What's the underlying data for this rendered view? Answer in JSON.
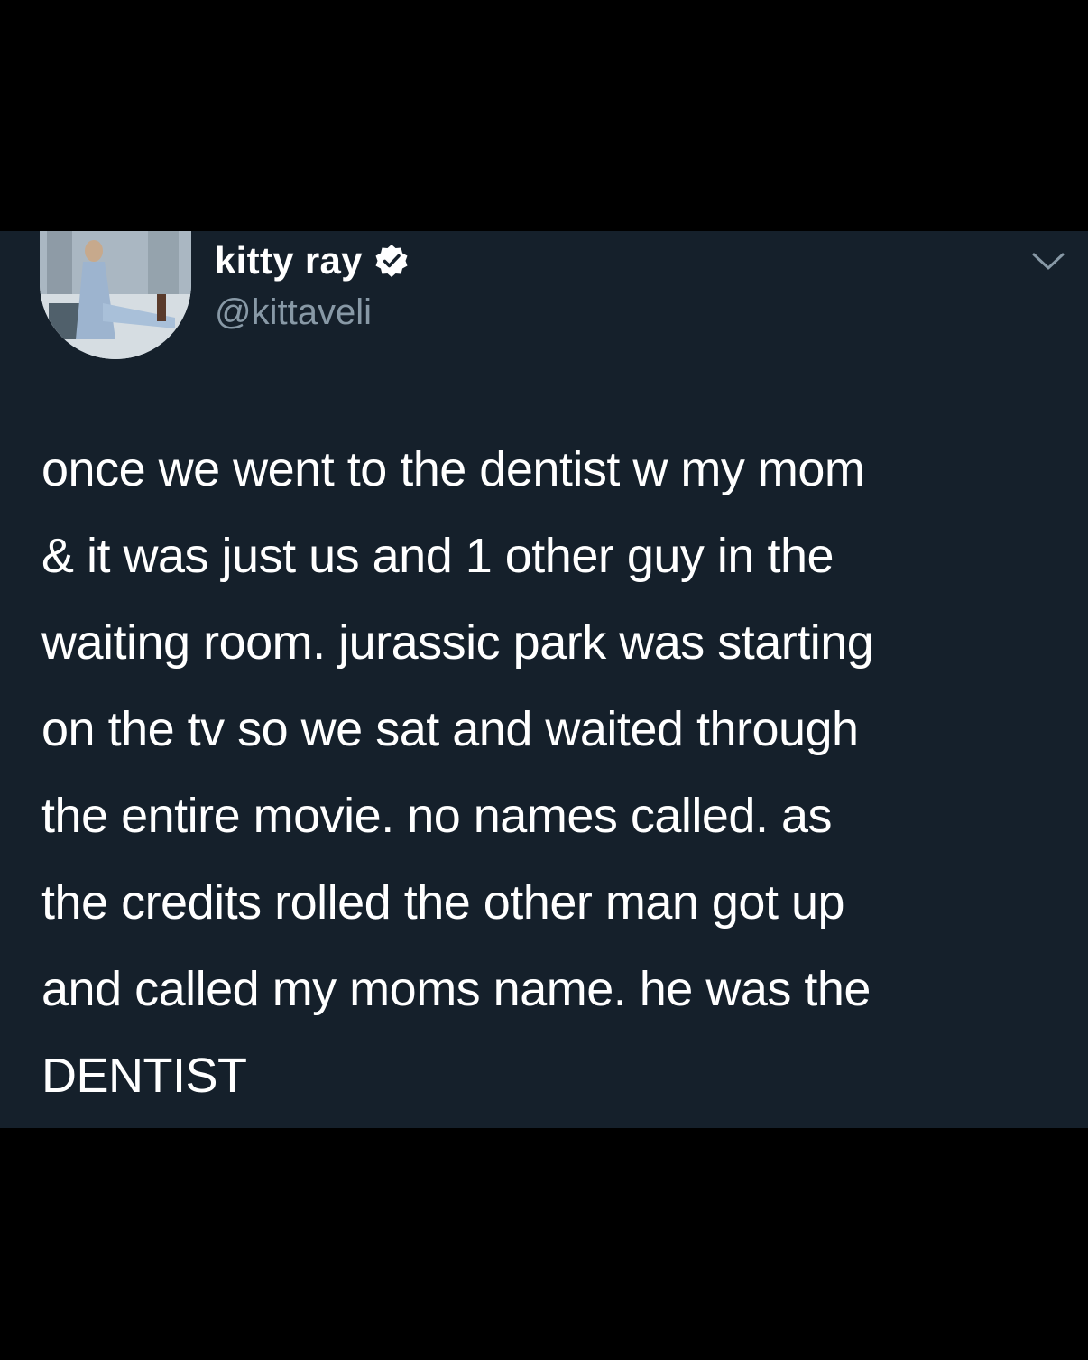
{
  "tweet": {
    "author": {
      "display_name": "kitty ray",
      "handle": "@kittaveli",
      "verified": true,
      "verified_icon": "verified-badge-icon",
      "avatar": "profile-photo"
    },
    "menu_icon": "chevron-down-icon",
    "text_lines": [
      "once we went to the dentist w my mom",
      "& it was just us and 1 other guy in the",
      "waiting room. jurassic park was starting",
      "on the tv so we sat and waited through",
      "the entire movie. no names called. as",
      "the credits rolled the other man got up",
      "and called my moms name. he was the",
      "DENTIST"
    ]
  },
  "colors": {
    "page_background": "#000000",
    "card_background": "#15202b",
    "primary_text": "#ffffff",
    "secondary_text": "#8899a6"
  }
}
